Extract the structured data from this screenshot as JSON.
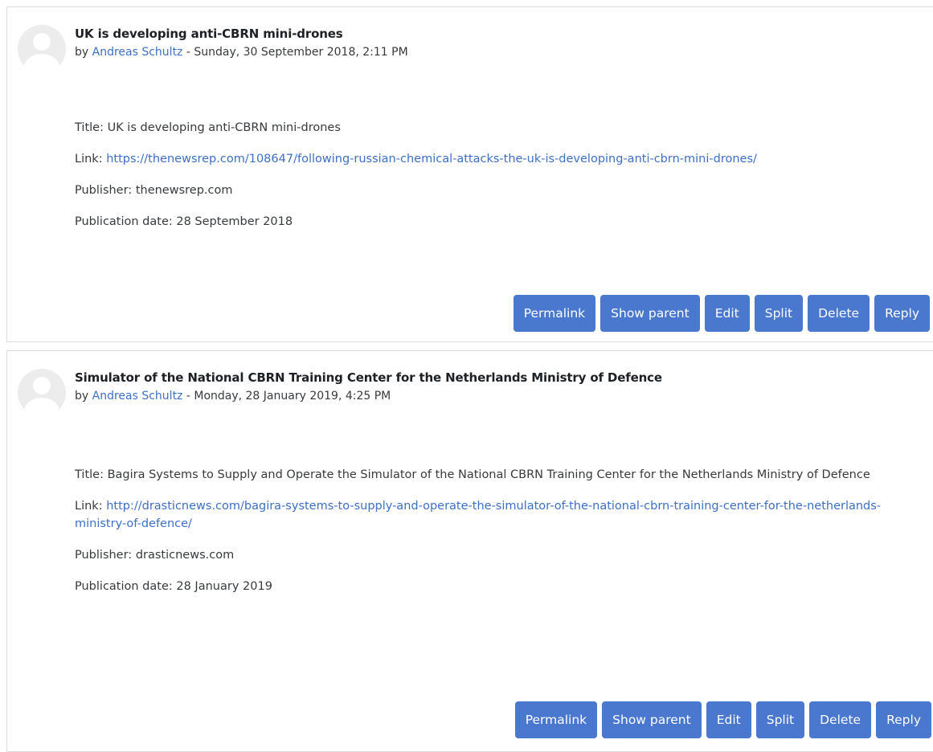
{
  "posts": [
    {
      "subject": "UK is developing anti-CBRN mini-drones",
      "by_prefix": "by ",
      "author": "Andreas Schultz",
      "date_sep": " - ",
      "date": "Sunday, 30 September 2018, 2:11 PM",
      "title_label": "Title: ",
      "title": "UK is developing anti-CBRN mini-drones",
      "link_label": "Link: ",
      "link": "https://thenewsrep.com/108647/following-russian-chemical-attacks-the-uk-is-developing-anti-cbrn-mini-drones/",
      "publisher_label": "Publisher: ",
      "publisher": "thenewsrep.com",
      "pubdate_label": "Publication date: ",
      "pubdate": "28 September 2018"
    },
    {
      "subject": "Simulator of the National CBRN Training Center for the Netherlands Ministry of Defence",
      "by_prefix": "by ",
      "author": "Andreas Schultz",
      "date_sep": " - ",
      "date": "Monday, 28 January 2019, 4:25 PM",
      "title_label": "Title: ",
      "title": "Bagira Systems to Supply and Operate the Simulator of the National CBRN Training Center for the Netherlands Ministry of Defence",
      "link_label": "Link: ",
      "link": "http://drasticnews.com/bagira-systems-to-supply-and-operate-the-simulator-of-the-national-cbrn-training-center-for-the-netherlands-ministry-of-defence/",
      "publisher_label": "Publisher: ",
      "publisher": "drasticnews.com",
      "pubdate_label": "Publication date: ",
      "pubdate": "28 January 2019"
    }
  ],
  "actions": {
    "permalink": "Permalink",
    "show_parent": "Show parent",
    "edit": "Edit",
    "split": "Split",
    "delete": "Delete",
    "reply": "Reply"
  },
  "colors": {
    "button": "#4a78cf",
    "link": "#3d6fc4",
    "border": "#dcdcdc"
  }
}
